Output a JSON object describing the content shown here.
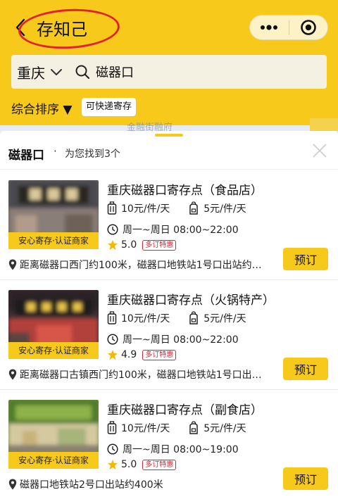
{
  "nav": {
    "title": "存知己",
    "back_icon": "chevron-left-icon",
    "more_icon": "more-dots-icon",
    "close_icon": "target-circle-icon"
  },
  "search": {
    "city": "重庆",
    "query": "磁器口",
    "search_icon": "search-icon"
  },
  "filters": {
    "sort_label": "综合排序 ▼",
    "express_chip": "可快递寄存"
  },
  "map_hint": "金融街融府",
  "results": {
    "title": "磁器口",
    "dot": "·",
    "count_text": "为您找到3个"
  },
  "cards": [
    {
      "name": "重庆磁器口寄存点（食品店）",
      "badge": "安心寄存·认证商家",
      "price_large": "10元/件/天",
      "price_small": "5元/件/天",
      "hours": "周一~周日 08:00~22:00",
      "rating": "5.0",
      "promo": "多订特惠",
      "address": "距离磁器口西门约100米，磁器口地铁站1号口出站约…",
      "button": "预订"
    },
    {
      "name": "重庆磁器口寄存点（火锅特产）",
      "badge": "安心寄存·认证商家",
      "price_large": "10元/件/天",
      "price_small": "5元/件/天",
      "hours": "周一~周日 08:00~22:00",
      "rating": "4.9",
      "promo": "多订特惠",
      "address": "距离磁器口古镇西门约100米，磁器口地铁站1号口出…",
      "button": "预订"
    },
    {
      "name": "重庆磁器口寄存点（副食店）",
      "badge": "安心寄存·认证商家",
      "price_large": "10元/件/天",
      "price_small": "5元/件/天",
      "hours": "周一~周日 08:00~19:00",
      "rating": "5.0",
      "promo": "多订特惠",
      "address": "磁器口地铁站2号口出站约400米",
      "button": "预订"
    }
  ],
  "colors": {
    "brand_yellow": "#f7c91a",
    "annotation_red": "#e0232f",
    "promo_red": "#e0232f"
  }
}
